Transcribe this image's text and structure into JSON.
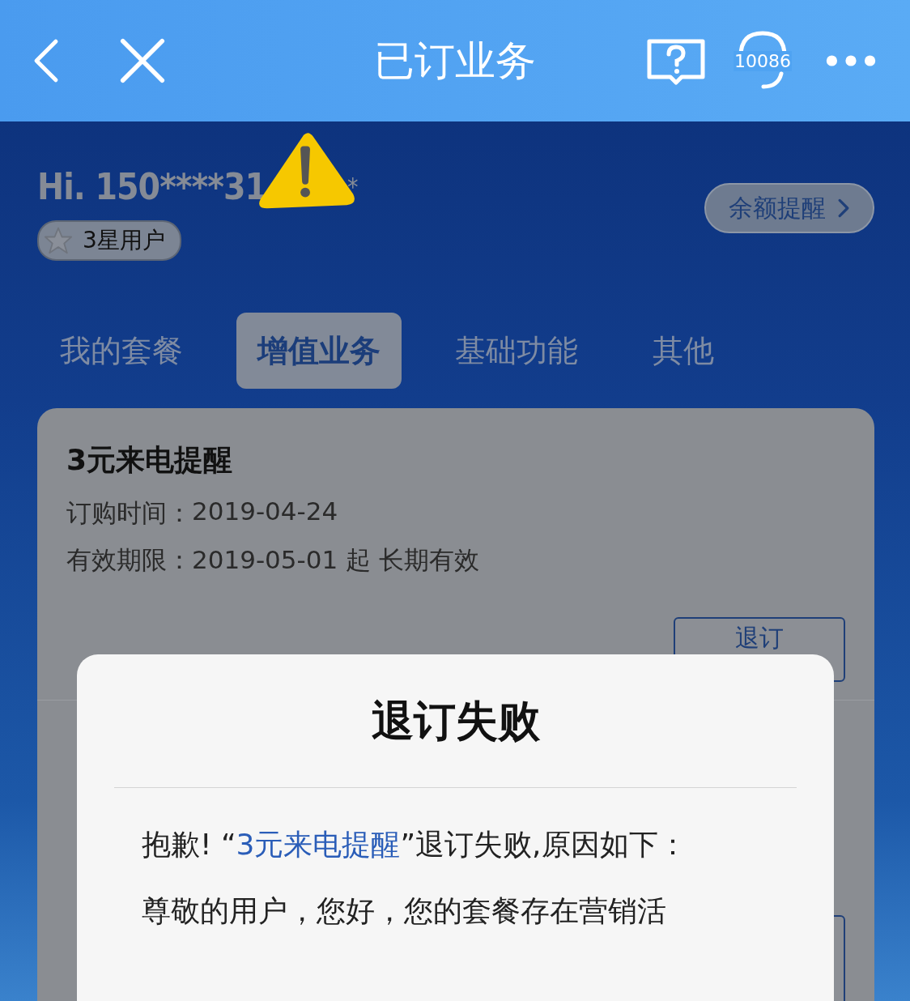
{
  "header": {
    "title": "已订业务",
    "hotline": "10086"
  },
  "user": {
    "greeting": "Hi. 150****31",
    "greeting_tail": "*",
    "level_badge": "3星用户",
    "balance_button": "余额提醒"
  },
  "tabs": [
    {
      "label": "我的套餐",
      "selected": false
    },
    {
      "label": "增值业务",
      "selected": true
    },
    {
      "label": "基础功能",
      "selected": false
    },
    {
      "label": "其他",
      "selected": false
    }
  ],
  "services": [
    {
      "name": "3元来电提醒",
      "rows": [
        {
          "label": "订购时间：",
          "value": "2019-04-24"
        },
        {
          "label": "有效期限：",
          "value": "2019-05-01 起 长期有效"
        }
      ],
      "action": "退订"
    }
  ],
  "dialog": {
    "title": "退订失败",
    "message_pre": "抱歉! “",
    "message_link": "3元来电提醒",
    "message_post": "”退订失败,原因如下：",
    "detail": "尊敬的用户，您好，您的套餐存在营销活"
  }
}
